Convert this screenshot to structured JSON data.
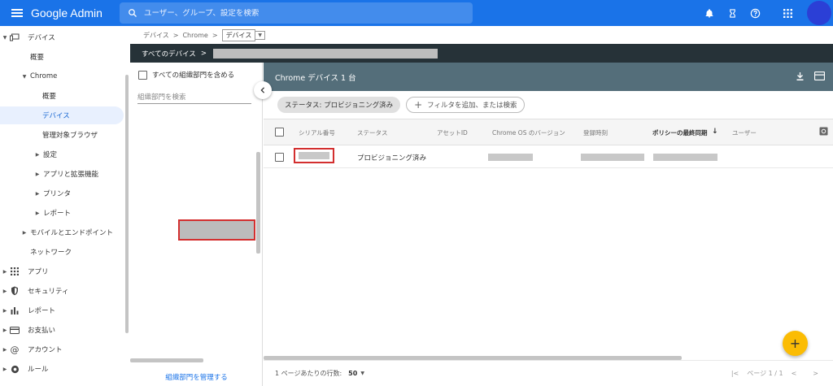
{
  "header": {
    "brand": "Google Admin",
    "search_placeholder": "ユーザー、グループ、設定を検索",
    "icons": [
      "bell-icon",
      "hourglass-icon",
      "help-icon",
      "apps-grid-icon",
      "avatar"
    ],
    "color": "#1a73e8"
  },
  "nav": {
    "items": [
      {
        "label": "デバイス",
        "icon": "devices-icon"
      },
      {
        "label": "概要"
      },
      {
        "label": "Chrome"
      },
      {
        "label": "概要"
      },
      {
        "label": "デバイス"
      },
      {
        "label": "管理対象ブラウザ"
      },
      {
        "label": "設定"
      },
      {
        "label": "アプリと拡張機能"
      },
      {
        "label": "プリンタ"
      },
      {
        "label": "レポート"
      },
      {
        "label": "モバイルとエンドポイント"
      },
      {
        "label": "ネットワーク"
      },
      {
        "label": "アプリ",
        "icon": "apps-icon"
      },
      {
        "label": "セキュリティ",
        "icon": "shield-icon"
      },
      {
        "label": "レポート",
        "icon": "bar-chart-icon"
      },
      {
        "label": "お支払い",
        "icon": "card-icon"
      },
      {
        "label": "アカウント",
        "icon": "at-icon"
      },
      {
        "label": "ルール",
        "icon": "rule-icon"
      }
    ]
  },
  "breadcrumb": {
    "items": [
      "デバイス",
      "Chrome"
    ],
    "current": "デバイス",
    "separator": ">"
  },
  "orgbar": {
    "label": "すべてのデバイス",
    "separator": ">"
  },
  "orgpanel": {
    "include_label": "すべての組織部門を含める",
    "search_placeholder": "組織部門を検索",
    "manage_label": "組織部門を管理する"
  },
  "main": {
    "title": "Chrome デバイス 1 台",
    "filter_chip": "ステータス: プロビジョニング済み",
    "add_filter": "フィルタを追加、または検索",
    "columns": [
      "シリアル番号",
      "ステータス",
      "アセットID",
      "Chrome OS のバージョン",
      "登録時刻",
      "ポリシーの最終同期",
      "ユーザー"
    ],
    "sort_icon": "↓",
    "rows": [
      {
        "status": "プロビジョニング済み"
      }
    ],
    "footer": {
      "rows_label": "1 ページあたりの行数:",
      "rows_value": "50",
      "page_label": "ページ 1 / 1"
    },
    "fab": "+",
    "accent": "#fbbc04"
  }
}
